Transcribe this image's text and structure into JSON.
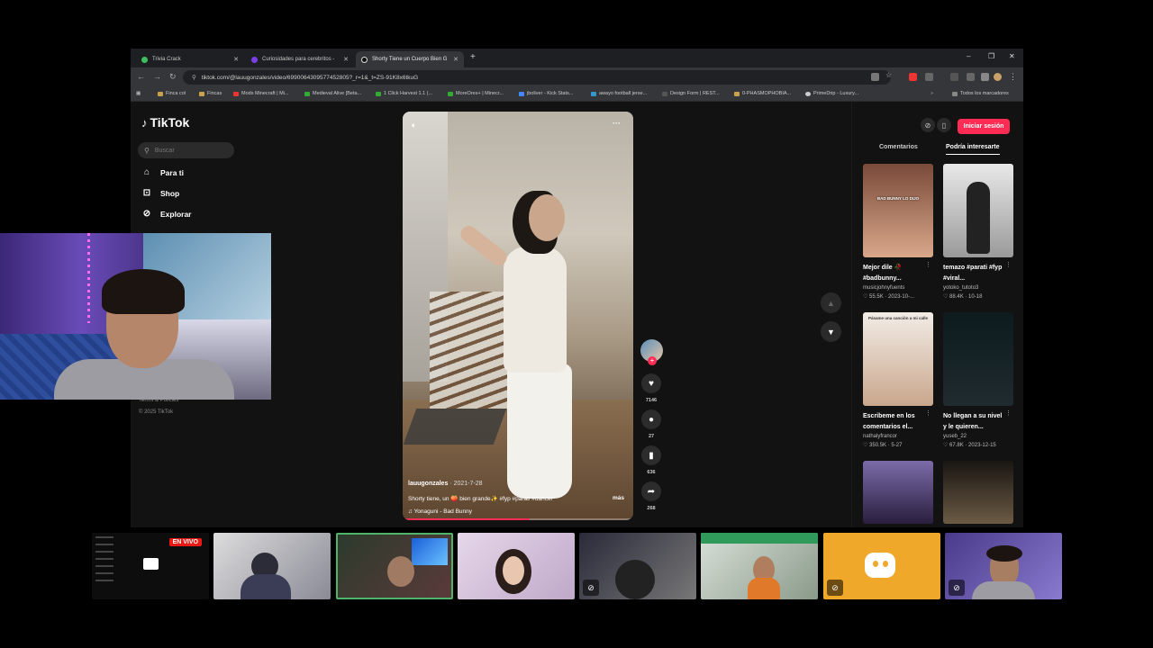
{
  "browser": {
    "tabs": [
      {
        "label": "Trivia Crack",
        "fav_color": "#3fbf5f"
      },
      {
        "label": "Curiosidades para cerebritos - ",
        "fav_color": "#7b3fe4"
      },
      {
        "label": "Shorty Tiene un Cuerpo Bien G",
        "fav_color": "#111111",
        "active": true
      }
    ],
    "new_tab": "+",
    "url": "tiktok.com/@lauugonzales/video/6990064309577452805?_r=1&_t=ZS-91K8x6tkuG",
    "bookmarks": [
      "Finca col",
      "Fincas",
      "Mods Minecraft | Mi...",
      "Medieval Alive [Beta...",
      "1 Click Harvest 1.1 (...",
      "MoreOres+ | Minecr...",
      "jboliver - Kick Stats...",
      "awayo football jerse...",
      "Design Form | REST...",
      "0-PHASMOPHOBIA...",
      "PrimeDrip - Luxury...",
      "Todos los marcadores"
    ]
  },
  "tiktok": {
    "logo": "TikTok",
    "search_placeholder": "Buscar",
    "nav": [
      "Para ti",
      "Shop",
      "Explorar"
    ],
    "footer": {
      "terms": "Terms & Policies",
      "copyright": "© 2025 TikTok"
    },
    "video": {
      "author": "lauugonzales",
      "date": "· 2021-7-28",
      "description": "Shorty tiene, un 🍑 bien grande✨ #fyp #parati #dancer",
      "more": "más",
      "song": "♫  Yonaguni - Bad Bunny",
      "likes": "7146",
      "comments": "27",
      "saves": "636",
      "shares": "268"
    },
    "right_panel": {
      "login": "Iniciar sesión",
      "tab_comments": "Comentarios",
      "tab_interest": "Podría interesarte",
      "cards": [
        {
          "title": "Mejor dile 🥀 #badbunny...",
          "user": "musicjohnyfuents",
          "meta": "♡ 55.5K · 2023-10-...",
          "overlay": "BAD BUNNY LO DIJO",
          "color1": "#7a4a3a",
          "color2": "#d9a88a"
        },
        {
          "title": "temazo #parati #fyp #viral...",
          "user": "yotoko_tutoto3",
          "meta": "♡ 88.4K · 10-18",
          "overlay": "",
          "color1": "#e8e8e8",
          "color2": "#9a9a9a"
        },
        {
          "title": "Escribeme en los comentarios el...",
          "user": "nathalyfrancor",
          "meta": "♡ 350.5K · 5-27",
          "overlay": "Pásame una canción a mi calle",
          "color1": "#f2ece6",
          "color2": "#c9a78c"
        },
        {
          "title": "No llegan a su nivel y le quieren...",
          "user": "yuseb_22",
          "meta": "♡ 67.8K · 2023-12-15",
          "overlay": "",
          "color1": "#0d1a1e",
          "color2": "#1f2b2e"
        },
        {
          "title": "",
          "user": "",
          "meta": "",
          "overlay": "",
          "color1": "#7b6ba8",
          "color2": "#2a1e3e"
        },
        {
          "title": "",
          "user": "",
          "meta": "",
          "overlay": "",
          "color1": "#1a1612",
          "color2": "#6b5a45"
        }
      ]
    }
  },
  "stream": {
    "live_badge": "EN VIVO"
  }
}
